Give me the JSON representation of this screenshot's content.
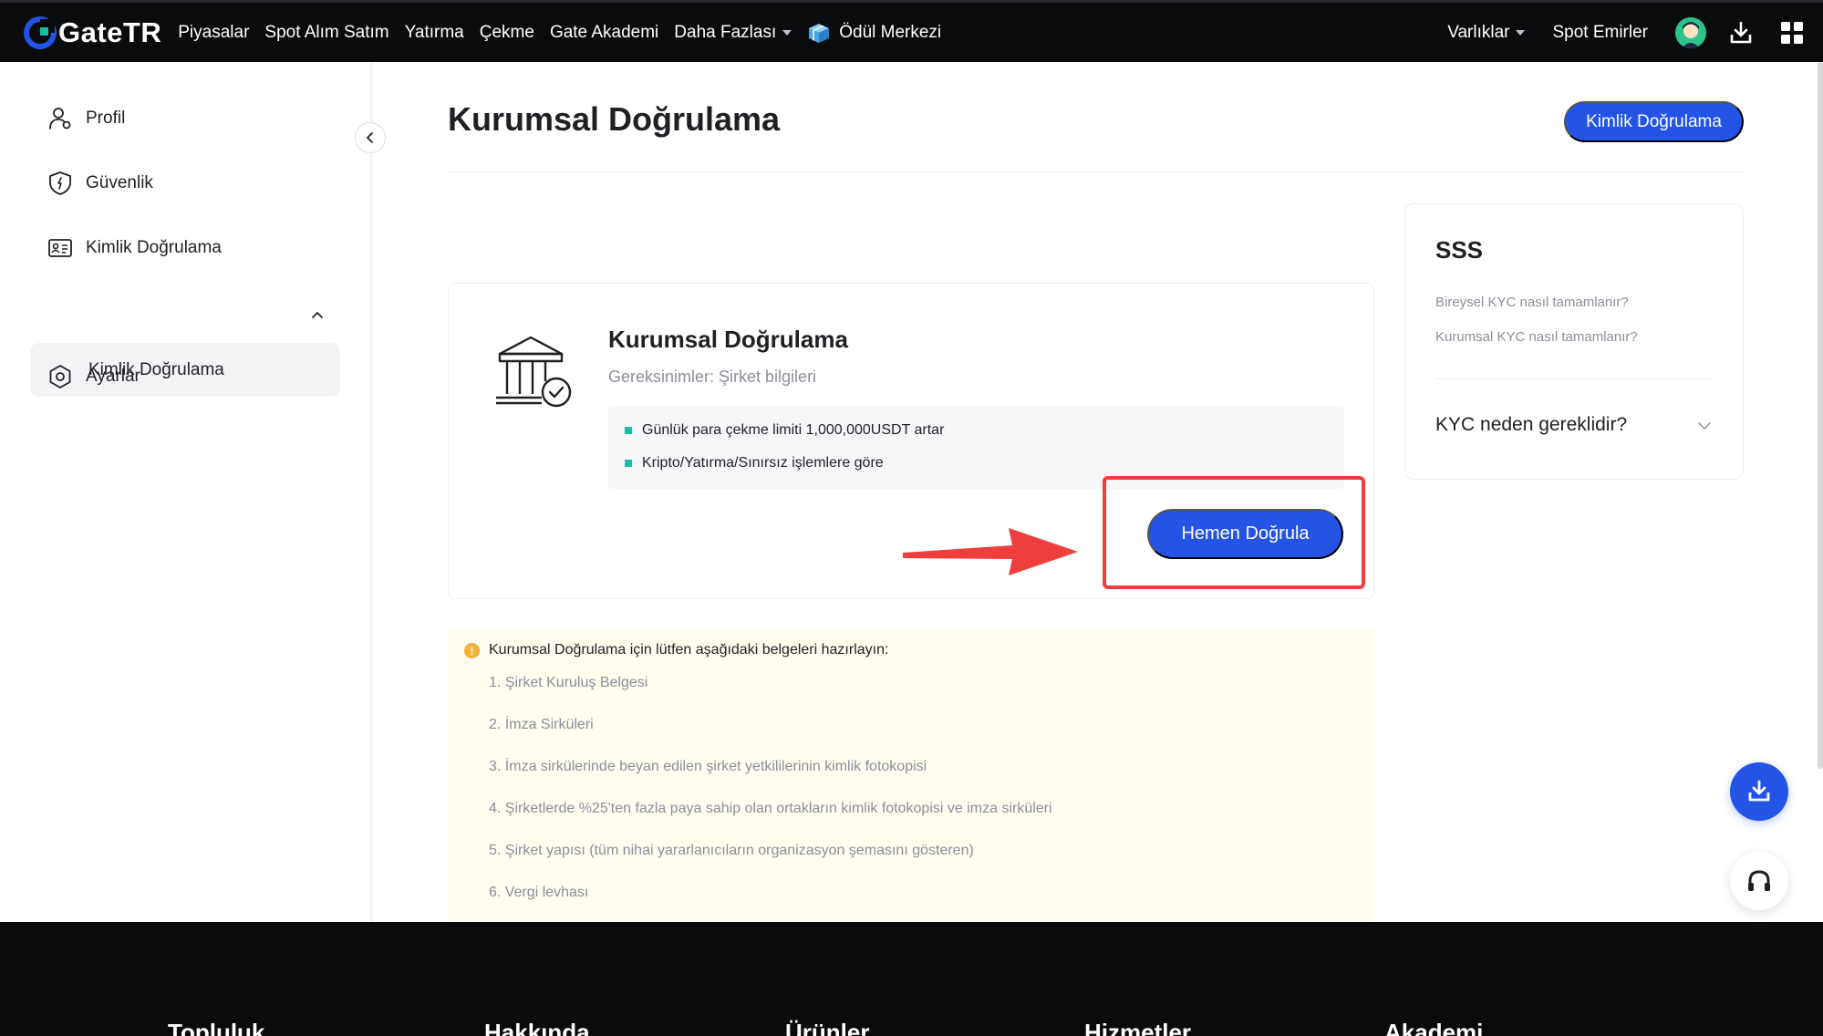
{
  "nav": {
    "logo_text": "GateTR",
    "items": [
      {
        "label": "Piyasalar"
      },
      {
        "label": "Spot Alım Satım"
      },
      {
        "label": "Yatırma"
      },
      {
        "label": "Çekme"
      },
      {
        "label": "Gate Akademi"
      },
      {
        "label": "Daha Fazlası"
      },
      {
        "label": "Ödül Merkezi"
      }
    ],
    "right": {
      "assets": "Varlıklar",
      "spot_orders": "Spot Emirler"
    }
  },
  "sidebar": {
    "items": [
      {
        "label": "Profil",
        "icon": "user-icon"
      },
      {
        "label": "Güvenlik",
        "icon": "shield-icon"
      },
      {
        "label": "Kimlik Doğrulama",
        "icon": "id-card-icon"
      },
      {
        "label": "Ayarlar",
        "icon": "settings-icon"
      }
    ],
    "sub_item": "Kimlik Doğrulama"
  },
  "main": {
    "title": "Kurumsal Doğrulama",
    "identity_button": "Kimlik Doğrulama",
    "card": {
      "title": "Kurumsal Doğrulama",
      "requirements": "Gereksinimler: Şirket bilgileri",
      "benefits": [
        "Günlük para çekme limiti 1,000,000USDT artar",
        "Kripto/Yatırma/Sınırsız işlemlere göre"
      ],
      "verify_button": "Hemen Doğrula"
    },
    "notice": {
      "title": "Kurumsal Doğrulama için lütfen aşağıdaki belgeleri hazırlayın:",
      "documents": [
        "1. Şirket Kuruluş Belgesi",
        "2. İmza Sirküleri",
        "3. İmza sirkülerinde beyan edilen şirket yetkililerinin kimlik fotokopisi",
        "4. Şirketlerde %25'ten fazla paya sahip olan ortakların kimlik fotokopisi ve imza sirküleri",
        "5. Şirket yapısı (tüm nihai yararlanıcıların organizasyon şemasını gösteren)",
        "6. Vergi levhası"
      ]
    }
  },
  "faq": {
    "title": "SSS",
    "links": [
      "Bireysel KYC nasıl tamamlanır?",
      "Kurumsal KYC nasıl tamamlanır?"
    ],
    "question": "KYC neden gereklidir?"
  },
  "footer": {
    "headings": [
      "Topluluk",
      "Hakkında",
      "Ürünler",
      "Hizmetler",
      "Akademi"
    ]
  },
  "colors": {
    "accent": "#2354e6",
    "highlight": "#ef3e3e",
    "bullet": "#18c0a0",
    "nav_bg": "#0a0b0d"
  }
}
